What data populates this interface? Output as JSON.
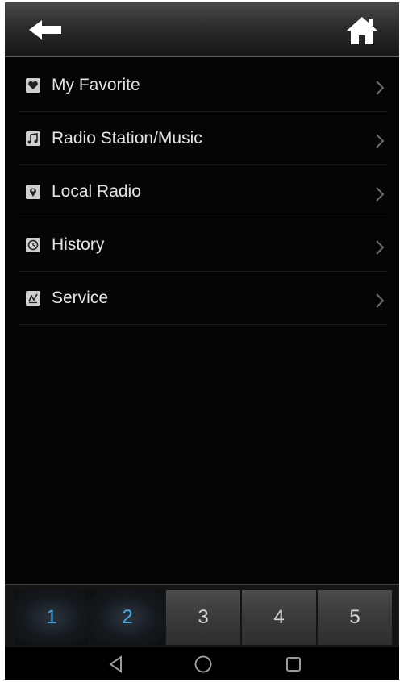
{
  "header": {
    "back_icon": "back-arrow-icon",
    "home_icon": "home-icon"
  },
  "menu": {
    "items": [
      {
        "label": "My Favorite",
        "icon": "heart-icon"
      },
      {
        "label": "Radio Station/Music",
        "icon": "music-note-icon"
      },
      {
        "label": "Local Radio",
        "icon": "location-pin-icon"
      },
      {
        "label": "History",
        "icon": "clock-icon"
      },
      {
        "label": "Service",
        "icon": "service-icon"
      }
    ]
  },
  "presets": {
    "items": [
      {
        "label": "1",
        "active": true
      },
      {
        "label": "2",
        "active": true
      },
      {
        "label": "3",
        "active": false
      },
      {
        "label": "4",
        "active": false
      },
      {
        "label": "5",
        "active": false
      }
    ]
  },
  "nav": {
    "back_icon": "triangle-back-icon",
    "home_icon": "circle-home-icon",
    "recents_icon": "square-recents-icon"
  },
  "colors": {
    "background": "#050505",
    "text": "#e4e4e4",
    "preset_active": "#4aa8e0",
    "preset_inactive": "#d6d6d6"
  }
}
